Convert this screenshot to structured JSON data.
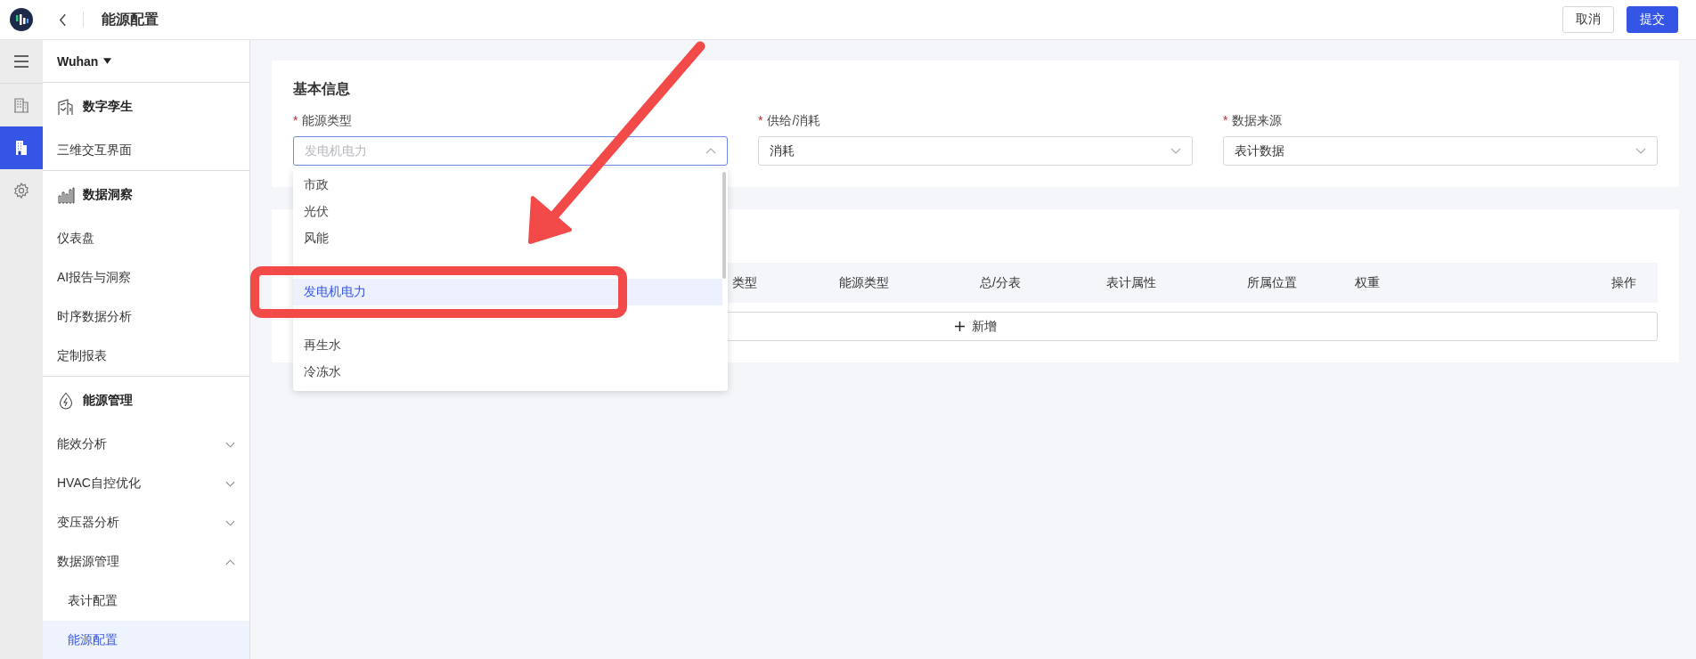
{
  "header": {
    "title": "能源配置",
    "buttons": [
      {
        "label": "取消",
        "kind": "secondary"
      },
      {
        "label": "提交",
        "kind": "primary"
      }
    ]
  },
  "rail": [
    {
      "selected": false
    },
    {
      "selected": true
    },
    {
      "selected": false
    }
  ],
  "sidebar": {
    "location": "Wuhan",
    "sections": [
      {
        "title": "数字孪生",
        "items": [
          {
            "label": "三维交互界面",
            "selected": false
          }
        ]
      },
      {
        "title": "数据洞察",
        "items": [
          {
            "label": "仪表盘",
            "selected": false
          },
          {
            "label": "AI报告与洞察",
            "selected": false
          },
          {
            "label": "时序数据分析",
            "selected": false
          },
          {
            "label": "定制报表",
            "selected": false
          }
        ]
      },
      {
        "title": "能源管理",
        "items": [
          {
            "label": "能效分析",
            "selected": false,
            "expanded": false
          },
          {
            "label": "HVAC自控优化",
            "selected": false,
            "expanded": false
          },
          {
            "label": "变压器分析",
            "selected": false,
            "expanded": false
          },
          {
            "label": "数据源管理",
            "selected": false,
            "expanded": true,
            "children": [
              {
                "label": "表计配置",
                "selected": false
              },
              {
                "label": "能源配置",
                "selected": true
              }
            ]
          }
        ]
      }
    ]
  },
  "form": {
    "title": "基本信息",
    "required_mark": "*",
    "fields": [
      {
        "label": "能源类型",
        "required": true,
        "placeholder": "发电机电力",
        "open": true
      },
      {
        "label": "供给/消耗",
        "required": true,
        "value": "消耗",
        "open": false
      },
      {
        "label": "数据来源",
        "required": true,
        "value": "表计数据",
        "open": false
      }
    ]
  },
  "dropdown": {
    "options": [
      {
        "label": "市政",
        "selected": false
      },
      {
        "label": "光伏",
        "selected": false
      },
      {
        "label": "风能",
        "selected": false
      },
      {
        "label": "发电机电力",
        "selected": true
      },
      {
        "label": "再生水",
        "selected": false
      },
      {
        "label": "冷冻水",
        "selected": false
      }
    ]
  },
  "table": {
    "columns": [
      "类型",
      "能源类型",
      "总/分表",
      "表计属性",
      "所属位置",
      "权重",
      "操作"
    ],
    "add_button": "新增"
  },
  "annotations": {
    "arrow": true,
    "highlight_frame": true
  }
}
